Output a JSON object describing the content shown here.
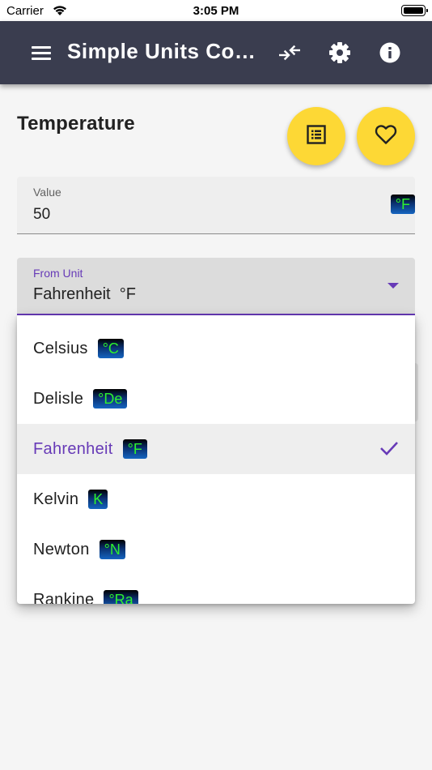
{
  "status_bar": {
    "carrier": "Carrier",
    "time": "3:05 PM"
  },
  "app_bar": {
    "title": "Simple Units Con…"
  },
  "section": {
    "title": "Temperature"
  },
  "value_field": {
    "label": "Value",
    "value": "50",
    "unit_symbol": "°F"
  },
  "from_unit": {
    "label": "From Unit",
    "value": "Fahrenheit  °F"
  },
  "menu": {
    "items": [
      {
        "name": "Celsius",
        "symbol": "°C",
        "selected": false
      },
      {
        "name": "Delisle",
        "symbol": "°De",
        "selected": false
      },
      {
        "name": "Fahrenheit",
        "symbol": "°F",
        "selected": true
      },
      {
        "name": "Kelvin",
        "symbol": "K",
        "selected": false
      },
      {
        "name": "Newton",
        "symbol": "°N",
        "selected": false
      },
      {
        "name": "Rankine",
        "symbol": "°Ra",
        "selected": false
      }
    ]
  },
  "icons": {
    "menu": "hamburger-menu-icon",
    "swap": "swap-arrows-icon",
    "settings": "gear-icon",
    "info": "info-icon",
    "list": "list-icon",
    "favorite": "heart-outline-icon",
    "check": "checkmark-icon"
  },
  "colors": {
    "app_bar": "#3a3d4f",
    "accent": "#673ab7",
    "fab": "#fdd835",
    "badge_text": "#2ef02e"
  }
}
